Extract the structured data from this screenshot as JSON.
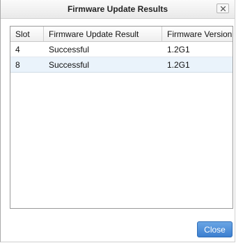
{
  "dialog": {
    "title": "Firmware Update Results",
    "close_icon": "close-icon"
  },
  "table": {
    "columns": [
      "Slot",
      "Firmware Update Result",
      "Firmware Version"
    ],
    "rows": [
      [
        "4",
        "Successful",
        "1.2G1"
      ],
      [
        "8",
        "Successful",
        "1.2G1"
      ]
    ]
  },
  "footer": {
    "close_label": "Close"
  },
  "colors": {
    "accent": "#4a8ad8",
    "selected_row": "#eaf3fb"
  }
}
